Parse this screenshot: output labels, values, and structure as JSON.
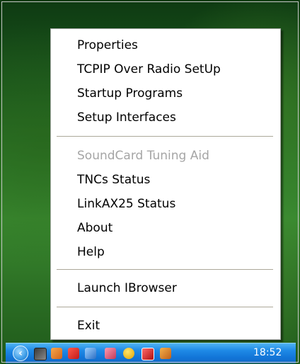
{
  "context_menu": {
    "items": [
      {
        "label": "Properties",
        "enabled": true
      },
      {
        "label": "TCPIP Over Radio SetUp",
        "enabled": true
      },
      {
        "label": "Startup Programs",
        "enabled": true
      },
      {
        "label": "Setup Interfaces",
        "enabled": true
      },
      {
        "label": "SoundCard Tuning Aid",
        "enabled": false
      },
      {
        "label": "TNCs Status",
        "enabled": true
      },
      {
        "label": "LinkAX25 Status",
        "enabled": true
      },
      {
        "label": "About",
        "enabled": true
      },
      {
        "label": "Help",
        "enabled": true
      },
      {
        "label": "Launch IBrowser",
        "enabled": true
      },
      {
        "label": "Exit",
        "enabled": true
      }
    ]
  },
  "taskbar": {
    "clock": "18:52",
    "tray_icons": [
      "show-hidden-icons-chevron",
      "packet-radio-icon",
      "tray-app-icon",
      "volume-icon",
      "network-icon",
      "security-shield-icon",
      "mail-icon",
      "tray-misc-icon"
    ]
  },
  "colors": {
    "taskbar": "#1f8ae6",
    "disabled_text": "#a5a5a5",
    "menu_bg": "#ffffff"
  }
}
